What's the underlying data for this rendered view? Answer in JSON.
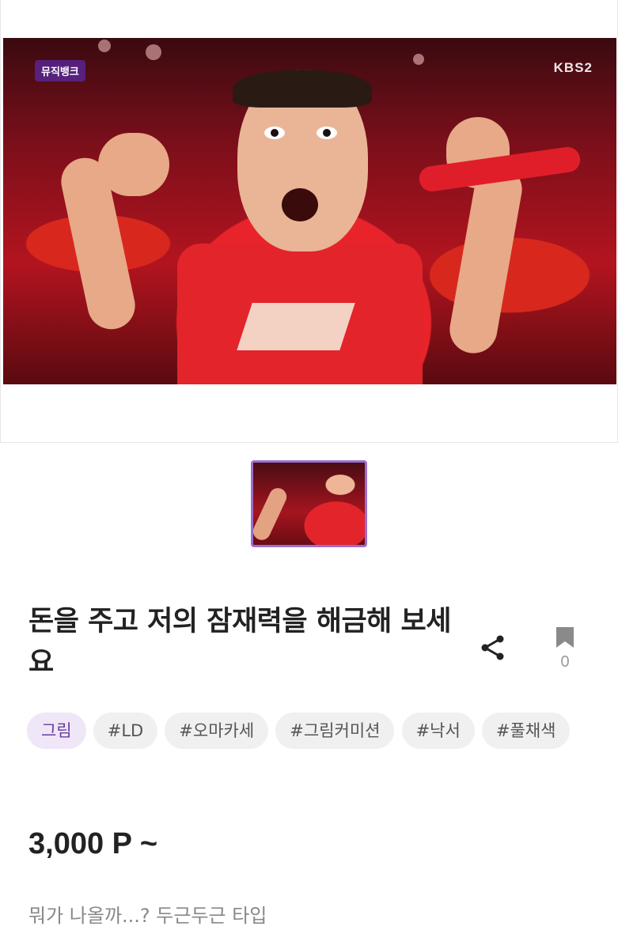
{
  "hero": {
    "broadcast_logo": "뮤직뱅크",
    "channel_logo": "KBS2"
  },
  "product": {
    "title": "돈을 주고 저의 잠재력을 해금해 보세요",
    "bookmark_count": "0",
    "category": "그림",
    "tags": [
      "#LD",
      "#오마카세",
      "#그림커미션",
      "#낙서",
      "#풀채색"
    ],
    "price": "3,000 P ~",
    "description": "뭐가 나올까...? 두근두근 타입"
  },
  "icons": {
    "share": "share-icon",
    "bookmark": "bookmark-icon"
  },
  "colors": {
    "accent": "#9a6fd0",
    "category_bg": "#efe6f7",
    "category_text": "#6a3d9a",
    "tag_bg": "#f0f0f0"
  }
}
